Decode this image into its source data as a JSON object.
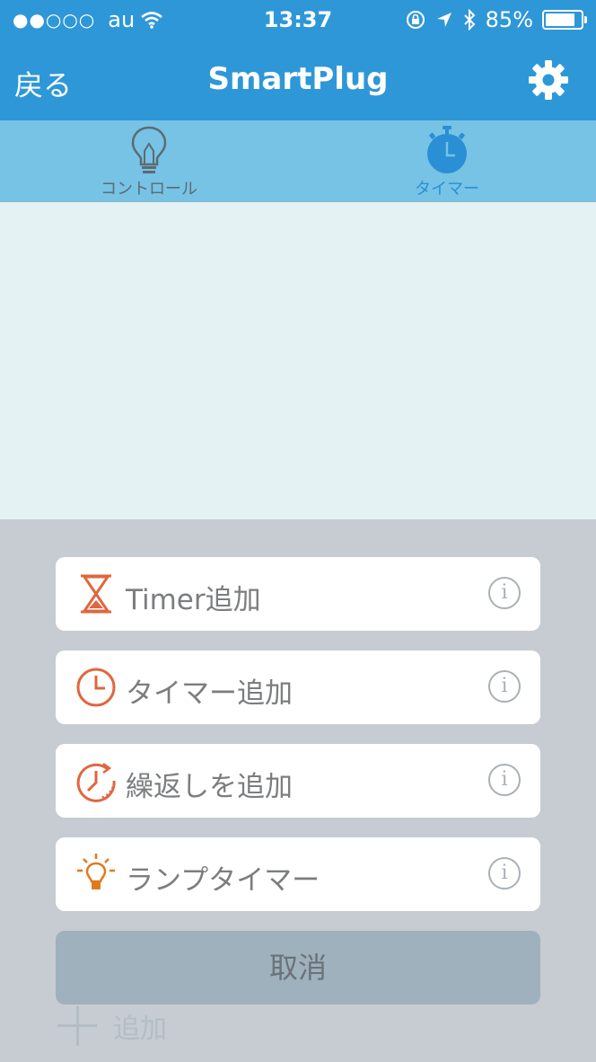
{
  "status_bar": {
    "signal": "●●○○○",
    "carrier": "au",
    "time": "13:37",
    "battery": "85%",
    "battery_level": 0.85
  },
  "navbar": {
    "back_label": "戻る",
    "title": "SmartPlug"
  },
  "tabs": [
    {
      "label": "コントロール",
      "icon": "lightbulb-icon",
      "active": false
    },
    {
      "label": "タイマー",
      "icon": "stopwatch-icon",
      "active": true
    }
  ],
  "action_sheet": {
    "options": [
      {
        "label": "Timer追加",
        "icon": "hourglass-icon"
      },
      {
        "label": "タイマー追加",
        "icon": "clock-icon"
      },
      {
        "label": "繰返しを追加",
        "icon": "repeat-clock-icon"
      },
      {
        "label": "ランプタイマー",
        "icon": "lamp-icon"
      }
    ],
    "info_glyph": "i",
    "cancel_label": "取消"
  },
  "add_row": {
    "label": "追加"
  },
  "colors": {
    "header": "#2e97d8",
    "tabbar": "#76c3e5",
    "content_bg": "#e4f2f3",
    "sheet_bg": "#c6ccd1",
    "accent_orange": "#e0663f",
    "cancel_bg": "#9fb1bd"
  }
}
